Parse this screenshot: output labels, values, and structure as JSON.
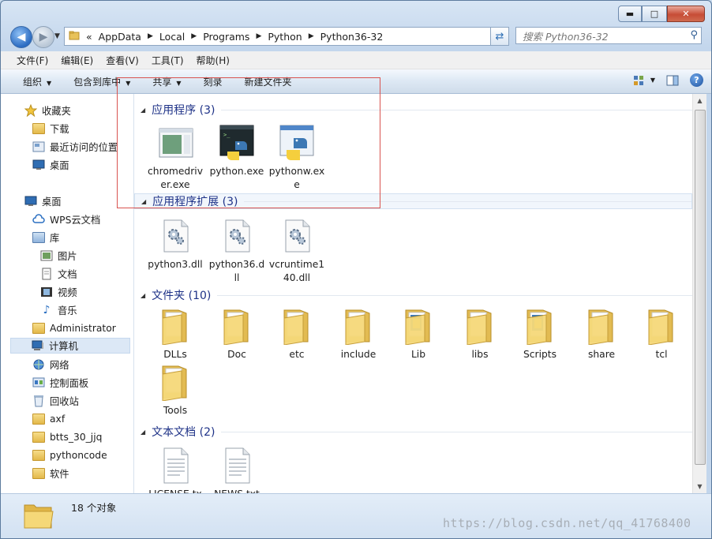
{
  "window": {
    "caption_buttons": {
      "minimize": "▬",
      "maximize": "□",
      "close": "✕"
    }
  },
  "address_bar": {
    "crumbs": [
      "AppData",
      "Local",
      "Programs",
      "Python",
      "Python36-32"
    ],
    "lead_sep": "«",
    "search_placeholder": "搜索 Python36-32"
  },
  "menubar": [
    "文件(F)",
    "编辑(E)",
    "查看(V)",
    "工具(T)",
    "帮助(H)"
  ],
  "toolbar": {
    "organize": "组织",
    "include_in_library": "包含到库中",
    "share": "共享",
    "burn": "刻录",
    "new_folder": "新建文件夹"
  },
  "nav_pane": {
    "favorites": "收藏夹",
    "downloads": "下载",
    "recent": "最近访问的位置",
    "desktop_fav": "桌面",
    "desktop": "桌面",
    "wps": "WPS云文档",
    "library": "库",
    "pictures": "图片",
    "documents": "文档",
    "videos": "视频",
    "music": "音乐",
    "admin": "Administrator",
    "computer": "计算机",
    "network": "网络",
    "control_panel": "控制面板",
    "recycle": "回收站",
    "f1": "axf",
    "f2": "btts_30_jjq",
    "f3": "pythoncode",
    "f4": "软件"
  },
  "groups": {
    "apps": {
      "title": "应用程序 (3)",
      "files": [
        "chromedriver.exe",
        "python.exe",
        "pythonw.exe"
      ]
    },
    "dlls": {
      "title": "应用程序扩展 (3)",
      "files": [
        "python3.dll",
        "python36.dll",
        "vcruntime140.dll"
      ]
    },
    "folders": {
      "title": "文件夹 (10)",
      "files": [
        "DLLs",
        "Doc",
        "etc",
        "include",
        "Lib",
        "libs",
        "Scripts",
        "share",
        "tcl",
        "Tools"
      ]
    },
    "texts": {
      "title": "文本文档 (2)",
      "files": [
        "LICENSE.tx",
        "NEWS.txt"
      ]
    }
  },
  "status": {
    "count": "18 个对象",
    "watermark": "https://blog.csdn.net/qq_41768400"
  },
  "colors": {
    "group_title": "#1e3287",
    "annotation": "#d9534f"
  }
}
